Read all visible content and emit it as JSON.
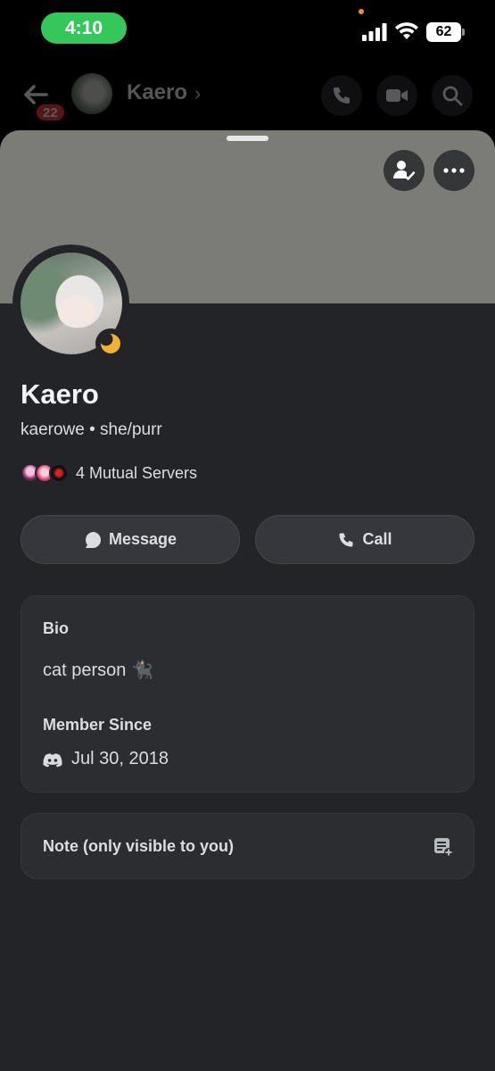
{
  "status_bar": {
    "time": "4:10",
    "battery": "62"
  },
  "background_header": {
    "unread_count": "22",
    "name": "Kaero",
    "chevron": "›"
  },
  "profile": {
    "display_name": "Kaero",
    "username": "kaerowe",
    "pronouns": "she/purr",
    "separator": " • ",
    "mutual_servers": "4 Mutual Servers"
  },
  "actions": {
    "message_label": "Message",
    "call_label": "Call"
  },
  "bio": {
    "label": "Bio",
    "text": "cat person 🐈‍⬛"
  },
  "member_since": {
    "label": "Member Since",
    "date": "Jul 30, 2018"
  },
  "note": {
    "label": "Note (only visible to you)"
  },
  "colors": {
    "time_pill": "#34c759",
    "sheet_bg": "#232428",
    "banner": "#7b7b78",
    "idle_status": "#f0b232",
    "badge_red": "#f23f43"
  },
  "icons": [
    "signal-icon",
    "wifi-icon",
    "battery-icon",
    "back-arrow-icon",
    "phone-icon",
    "video-icon",
    "search-icon",
    "friend-check-icon",
    "more-icon",
    "moon-idle-icon",
    "chat-bubble-icon",
    "discord-icon",
    "note-add-icon"
  ]
}
